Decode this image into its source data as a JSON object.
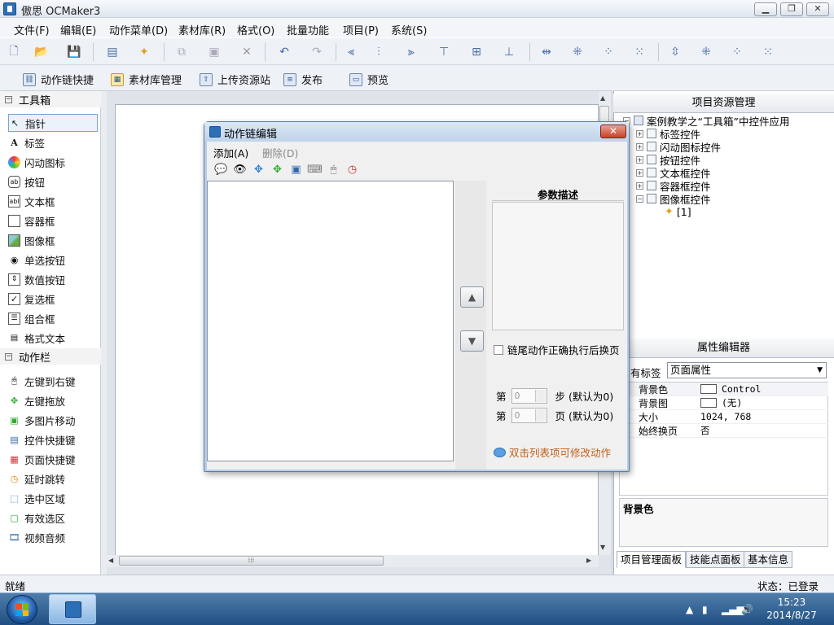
{
  "window": {
    "title": "傲思 OCMaker3"
  },
  "menubar": [
    "文件(F)",
    "编辑(E)",
    "动作菜单(D)",
    "素材库(R)",
    "格式(O)",
    "批量功能",
    "项目(P)",
    "系统(S)"
  ],
  "toolbar2": {
    "items": [
      "动作链快捷",
      "素材库管理",
      "上传资源站",
      "发布",
      "预览"
    ]
  },
  "toolbox": {
    "section1": "工具箱",
    "tools": [
      "指针",
      "标签",
      "闪动图标",
      "按钮",
      "文本框",
      "容器框",
      "图像框",
      "单选按钮",
      "数值按钮",
      "复选框",
      "组合框",
      "格式文本"
    ],
    "section2": "动作栏",
    "actions": [
      "左键到右键",
      "左键拖放",
      "多图片移动",
      "控件快捷键",
      "页面快捷键",
      "延时跳转",
      "选中区域",
      "有效选区",
      "视频音频"
    ]
  },
  "project": {
    "title": "项目资源管理",
    "root": "案例教学之“工具箱”中控件应用",
    "children": [
      "标签控件",
      "闪动图标控件",
      "按钮控件",
      "文本框控件",
      "容器框控件",
      "图像框控件"
    ],
    "leaf": "[1]"
  },
  "props": {
    "title": "属性编辑器",
    "label_prefix": "有标签",
    "selected": "页面属性",
    "rows": [
      {
        "name": "背景色",
        "value": "Control"
      },
      {
        "name": "背景图",
        "value": "(无)"
      },
      {
        "name": "大小",
        "value": "1024, 768"
      },
      {
        "name": "始终换页",
        "value": "否"
      }
    ],
    "desc_title": "背景色"
  },
  "bottom_tabs": [
    "项目管理面板",
    "技能点面板",
    "基本信息"
  ],
  "status": {
    "left": "就绪",
    "right": "状态：已登录"
  },
  "clock": {
    "time": "15:23",
    "date": "2014/8/27"
  },
  "dialog": {
    "title": "动作链编辑",
    "menu": {
      "add": "添加(A)",
      "delete": "删除(D)"
    },
    "param_title": "参数描述",
    "checkbox_label": "链尾动作正确执行后换页",
    "step_row": {
      "prefix": "第",
      "value": "0",
      "suffix": "步 (默认为0)"
    },
    "page_row": {
      "prefix": "第",
      "value": "0",
      "suffix": "页 (默认为0)"
    },
    "hint": "双击列表项可修改动作"
  }
}
